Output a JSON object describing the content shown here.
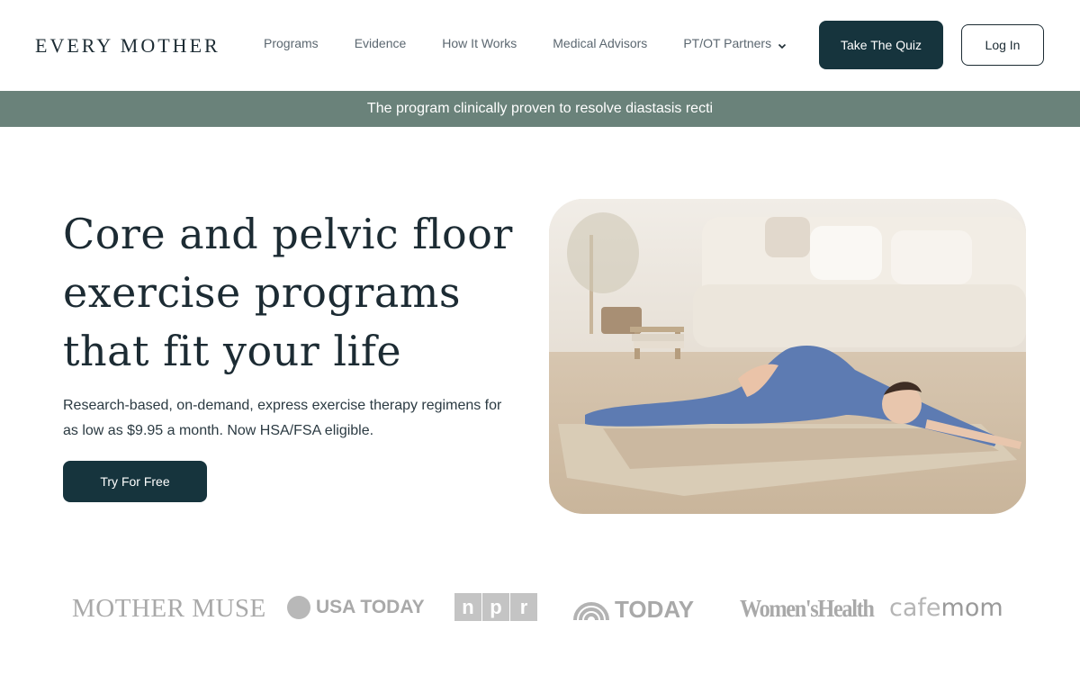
{
  "header": {
    "logo": "EVERY MOTHER",
    "nav": [
      {
        "label": "Programs"
      },
      {
        "label": "Evidence"
      },
      {
        "label": "How It Works"
      },
      {
        "label": "Medical Advisors"
      },
      {
        "label": "PT/OT Partners",
        "has_dropdown": true
      }
    ],
    "quiz_button": "Take The Quiz",
    "login_button": "Log In"
  },
  "banner": {
    "text": "The program clinically proven to resolve diastasis recti"
  },
  "hero": {
    "title_lines": [
      "Core and pelvic floor",
      "exercise programs",
      "that fit your life"
    ],
    "subtitle_lines": [
      "Research-based, on-demand, express exercise therapy regimens for",
      "as low as $9.95 a month. Now HSA/FSA eligible."
    ],
    "cta": "Try For Free"
  },
  "press": {
    "mother_muse": "MOTHER MUSE",
    "usa_today": "USA TODAY",
    "npr": [
      "n",
      "p",
      "r"
    ],
    "today": "TODAY",
    "womens_health": "Women'sHealth",
    "cafemom_a": "cafe",
    "cafemom_b": "mom"
  },
  "colors": {
    "primary_dark": "#16343d",
    "banner_bg": "#6a827a",
    "text": "#1c2b33",
    "press_gray": "#a9a9a9"
  }
}
